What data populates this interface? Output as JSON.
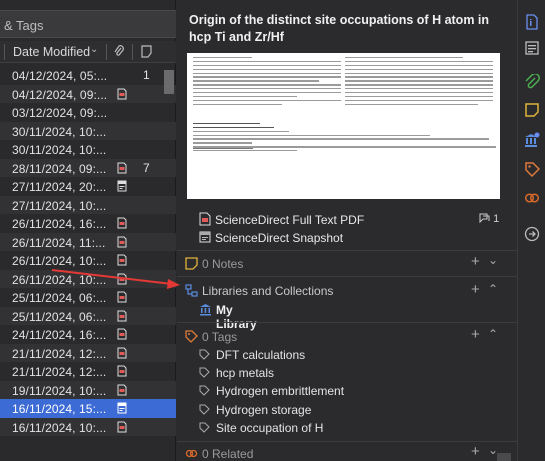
{
  "search": {
    "placeholder": "& Tags"
  },
  "columns": {
    "date_modified": "Date Modified",
    "sort_icon": "chevron-down-icon"
  },
  "items": [
    {
      "date": "04/12/2024, 05:...",
      "attachment": "none",
      "notes": "1"
    },
    {
      "date": "04/12/2024, 09:...",
      "attachment": "pdf",
      "notes": ""
    },
    {
      "date": "03/12/2024, 09:...",
      "attachment": "none",
      "notes": ""
    },
    {
      "date": "30/11/2024, 10:...",
      "attachment": "none",
      "notes": ""
    },
    {
      "date": "30/11/2024, 10:...",
      "attachment": "none",
      "notes": ""
    },
    {
      "date": "28/11/2024, 09:...",
      "attachment": "pdf",
      "notes": "7"
    },
    {
      "date": "27/11/2024, 20:...",
      "attachment": "snapshot",
      "notes": ""
    },
    {
      "date": "27/11/2024, 10:...",
      "attachment": "none",
      "notes": ""
    },
    {
      "date": "26/11/2024, 16:...",
      "attachment": "pdf",
      "notes": ""
    },
    {
      "date": "26/11/2024, 11:...",
      "attachment": "pdf",
      "notes": ""
    },
    {
      "date": "26/11/2024, 10:...",
      "attachment": "pdf",
      "notes": ""
    },
    {
      "date": "26/11/2024, 10:...",
      "attachment": "pdf",
      "notes": ""
    },
    {
      "date": "25/11/2024, 06:...",
      "attachment": "pdf",
      "notes": ""
    },
    {
      "date": "25/11/2024, 06:...",
      "attachment": "pdf",
      "notes": ""
    },
    {
      "date": "24/11/2024, 16:...",
      "attachment": "pdf",
      "notes": ""
    },
    {
      "date": "21/11/2024, 12:...",
      "attachment": "pdf",
      "notes": ""
    },
    {
      "date": "21/11/2024, 12:...",
      "attachment": "pdf",
      "notes": ""
    },
    {
      "date": "19/11/2024, 10:...",
      "attachment": "pdf",
      "notes": ""
    },
    {
      "date": "16/11/2024, 15:...",
      "attachment": "snapshot",
      "notes": "",
      "selected": true
    },
    {
      "date": "16/11/2024, 10:...",
      "attachment": "pdf",
      "notes": ""
    }
  ],
  "detail": {
    "title": "Origin of the distinct site occupations of H atom in hcp Ti and Zr/Hf",
    "attachments": [
      {
        "label": "ScienceDirect Full Text PDF",
        "icon": "pdf-icon"
      },
      {
        "label": "ScienceDirect Snapshot",
        "icon": "snapshot-icon"
      }
    ],
    "attachment_count": "1",
    "notes_header": "0 Notes",
    "libraries_header": "Libraries and Collections",
    "library": "My Library",
    "tags_header": "0 Tags",
    "tags": [
      "DFT calculations",
      "hcp metals",
      "Hydrogen embrittlement",
      "Hydrogen storage",
      "Site occupation of H"
    ],
    "related_header": "0 Related"
  },
  "colors": {
    "selection": "#3d6bd6",
    "annotation_arrow": "#e53935",
    "pdf_red": "#e05a5a",
    "notes_yellow": "#e0b43a",
    "tags_orange": "#e07a3a",
    "library_blue": "#5a8ce0",
    "related_orange": "#d96a2a"
  },
  "sidenav_icons": [
    "info-icon",
    "abstract-icon",
    "attachments-icon",
    "notes-icon",
    "libraries-icon",
    "tags-icon",
    "related-icon",
    "locate-icon"
  ]
}
